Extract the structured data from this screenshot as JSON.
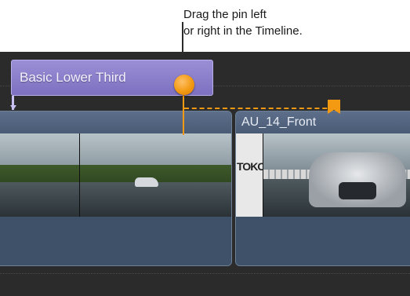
{
  "callout": {
    "line1": "Drag the pin left",
    "line2": "or right in the Timeline."
  },
  "title_clip": {
    "label": "Basic Lower Third"
  },
  "clips": [
    {
      "name": ""
    },
    {
      "name": "AU_14_Front"
    }
  ],
  "thumbnails": {
    "wall_text": "TOKOH"
  },
  "colors": {
    "pin": "#f39a12",
    "title_clip": "#8a7fcc",
    "clip": "#44556e",
    "timeline_bg": "#2b2b2b"
  }
}
